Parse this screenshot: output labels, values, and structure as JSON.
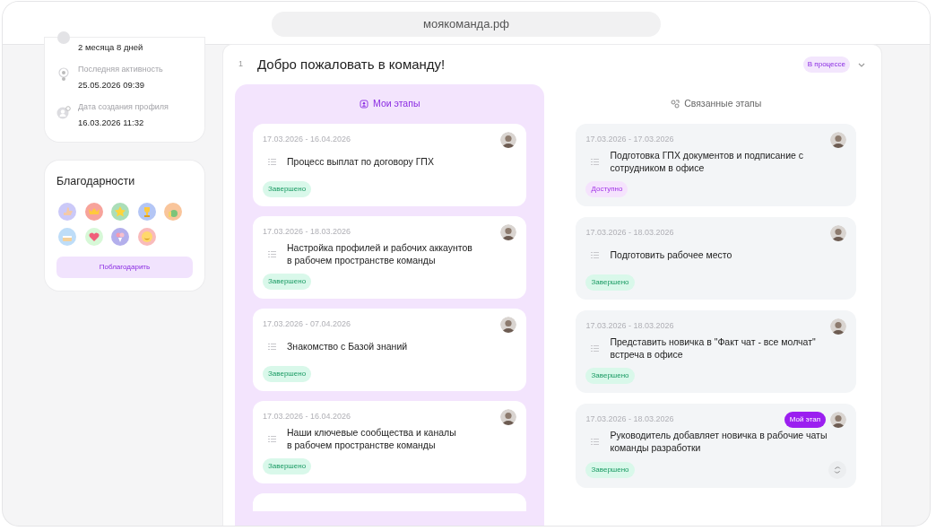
{
  "address_bar": {
    "url": "моякоманда.рф"
  },
  "profile_info": [
    {
      "kind": "tenure",
      "value": "2 месяца 8 дней"
    },
    {
      "kind": "activity",
      "label": "Последняя активность",
      "value": "25.05.2026 09:39"
    },
    {
      "kind": "created",
      "label": "Дата создания профиля",
      "value": "16.03.2026 11:32"
    }
  ],
  "thanks": {
    "title": "Благодарности",
    "button": "Поблагодарить"
  },
  "section": {
    "number": "1",
    "title": "Добро пожаловать в команду!",
    "status": "В процессе",
    "expanded": true
  },
  "tabs": [
    {
      "label": "Мои этапы",
      "selected": true
    },
    {
      "label": "Связанные этапы",
      "selected": false
    }
  ],
  "my_stages": [
    {
      "dates": "17.03.2026 - 16.04.2026",
      "title": "Процесс выплат по договору ГПХ",
      "status": "Завершено",
      "kind": "done"
    },
    {
      "dates": "17.03.2026 - 18.03.2026",
      "title": "Настройка профилей и рабочих аккаунтов\nв рабочем пространстве команды",
      "status": "Завершено",
      "kind": "done"
    },
    {
      "dates": "17.03.2026 - 07.04.2026",
      "title": "Знакомство с Базой знаний",
      "status": "Завершено",
      "kind": "done"
    },
    {
      "dates": "17.03.2026 - 16.04.2026",
      "title": "Наши ключевые сообщества и каналы\nв рабочем пространстве команды",
      "status": "Завершено",
      "kind": "done"
    }
  ],
  "related_stages": [
    {
      "dates": "17.03.2026 - 17.03.2026",
      "title": "Подготовка ГПХ документов и подписание с\nсотрудником в офисе",
      "status": "Доступно",
      "kind": "available"
    },
    {
      "dates": "17.03.2026 - 18.03.2026",
      "title": "Подготовить рабочее место",
      "status": "Завершено",
      "kind": "done"
    },
    {
      "dates": "17.03.2026 - 18.03.2026",
      "title": "Представить новичка в \"Факт чат - все молчат\"\nвстреча в офисе",
      "status": "Завершено",
      "kind": "done"
    },
    {
      "dates": "17.03.2026 - 18.03.2026",
      "title": "Руководитель добавляет новичка в рабочие чаты\nкоманды разработки",
      "status": "Завершено",
      "kind": "done",
      "tag": "Мой этап",
      "refresh": true
    }
  ]
}
